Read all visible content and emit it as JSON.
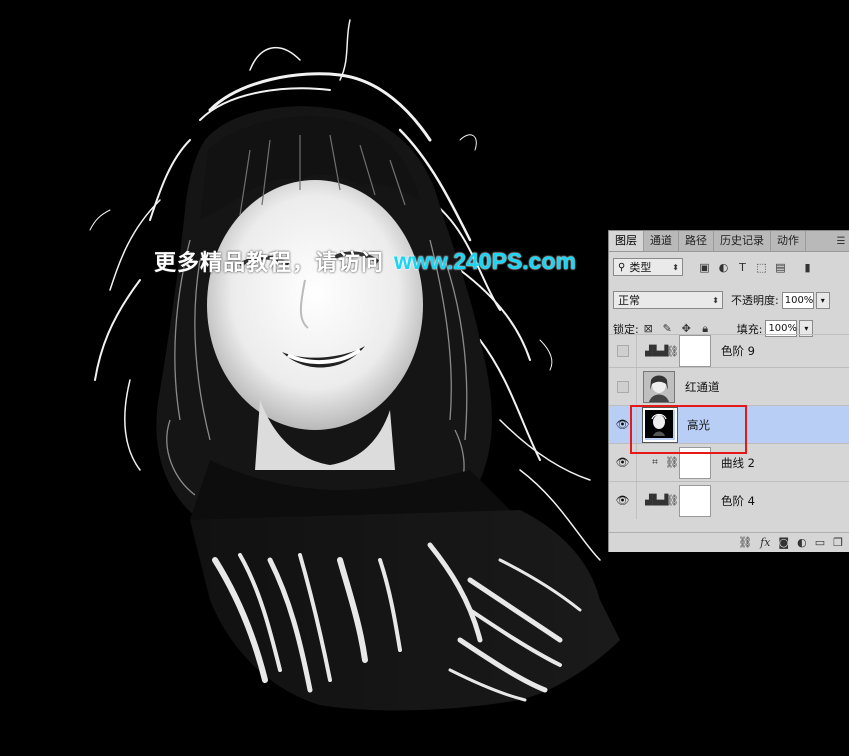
{
  "watermark": {
    "text_cn": "更多精品教程，请访问",
    "url": "www.240PS.com"
  },
  "panel": {
    "tabs": [
      "图层",
      "通道",
      "路径",
      "历史记录",
      "动作"
    ],
    "active_tab": "图层",
    "filter_label": "类型",
    "blend_mode": "正常",
    "opacity_label": "不透明度:",
    "opacity_value": "100%",
    "lock_label": "锁定:",
    "fill_label": "填充:",
    "fill_value": "100%",
    "layers": [
      {
        "name": "色阶 9",
        "type": "levels",
        "visible": false
      },
      {
        "name": "红通道",
        "type": "image",
        "visible": false
      },
      {
        "name": "高光",
        "type": "image",
        "visible": true,
        "selected": true
      },
      {
        "name": "曲线 2",
        "type": "curves",
        "visible": true
      },
      {
        "name": "色阶 4",
        "type": "levels",
        "visible": true
      }
    ],
    "footer_icons": [
      "link-icon",
      "fx-icon",
      "mask-icon",
      "adjustment-icon",
      "folder-icon",
      "new-layer-icon"
    ]
  },
  "colors": {
    "watermark_url": "#18d6f4",
    "selection_highlight": "#b8cef5",
    "annotation_box": "#e61919"
  }
}
